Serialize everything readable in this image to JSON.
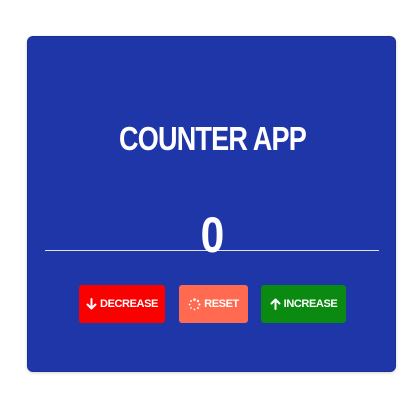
{
  "app": {
    "title": "COUNTER APP",
    "count": "0"
  },
  "buttons": {
    "decrease": {
      "label": "DECREASE",
      "icon": "arrow-down-icon",
      "color": "#fb0000"
    },
    "reset": {
      "label": "RESET",
      "icon": "spinner-icon",
      "color": "#ff6a50"
    },
    "increase": {
      "label": "INCREASE",
      "icon": "arrow-up-icon",
      "color": "#0a8a11"
    }
  },
  "theme": {
    "card_background": "#1f36a8",
    "text_color": "#ffffff"
  }
}
